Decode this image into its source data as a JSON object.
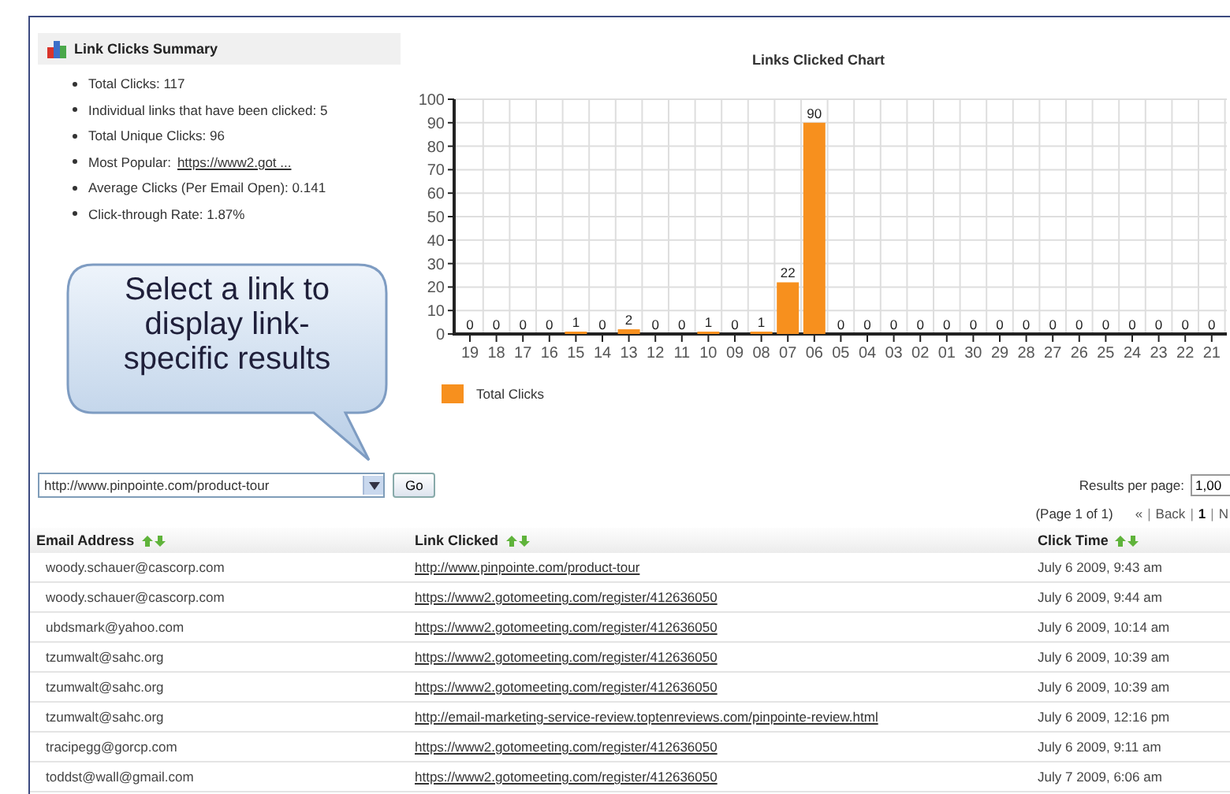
{
  "summary": {
    "title": "Link Clicks Summary",
    "items": [
      {
        "kind": "text",
        "label": "Total Clicks: 117"
      },
      {
        "kind": "text",
        "label": "Individual links that have been clicked: 5"
      },
      {
        "kind": "text",
        "label": "Total Unique Clicks: 96"
      },
      {
        "kind": "link",
        "label": "Most Popular:",
        "link": "https://www2.got ..."
      },
      {
        "kind": "text",
        "label": "Average Clicks (Per Email Open): 0.141"
      },
      {
        "kind": "text",
        "label": "Click-through Rate: 1.87%"
      }
    ]
  },
  "chart_data": {
    "type": "bar",
    "title": "Links Clicked Chart",
    "categories": [
      "19",
      "18",
      "17",
      "16",
      "15",
      "14",
      "13",
      "12",
      "11",
      "10",
      "09",
      "08",
      "07",
      "06",
      "05",
      "04",
      "03",
      "02",
      "01",
      "30",
      "29",
      "28",
      "27",
      "26",
      "25",
      "24",
      "23",
      "22",
      "21"
    ],
    "series": [
      {
        "name": "Total Clicks",
        "color": "#f7901e",
        "values": [
          0,
          0,
          0,
          0,
          1,
          0,
          2,
          0,
          0,
          1,
          0,
          1,
          22,
          90,
          0,
          0,
          0,
          0,
          0,
          0,
          0,
          0,
          0,
          0,
          0,
          0,
          0,
          0,
          0
        ]
      }
    ],
    "ylim": [
      0,
      100
    ],
    "yticks": [
      0,
      10,
      20,
      30,
      40,
      50,
      60,
      70,
      80,
      90,
      100
    ],
    "data_labels": true,
    "grid": true
  },
  "callout": "Select a link to display link-specific results",
  "link_selector": {
    "value": "http://www.pinpointe.com/product-tour"
  },
  "go_button": "Go",
  "results_per_page": {
    "label": "Results per page:",
    "value": "1,00"
  },
  "pagination": {
    "page_info": "(Page 1 of 1)",
    "separator": "|",
    "links": [
      {
        "label": "«",
        "selected": false
      },
      {
        "label": "Back",
        "selected": false
      },
      {
        "label": "1",
        "selected": true
      },
      {
        "label": "N",
        "selected": false
      }
    ]
  },
  "table": {
    "columns": [
      "Email Address",
      "Link Clicked",
      "Click Time"
    ],
    "rows": [
      {
        "email": "woody.schauer@cascorp.com",
        "link": "http://www.pinpointe.com/product-tour",
        "time": "July 6 2009, 9:43 am"
      },
      {
        "email": "woody.schauer@cascorp.com",
        "link": "https://www2.gotomeeting.com/register/412636050",
        "time": "July 6 2009, 9:44 am"
      },
      {
        "email": "ubdsmark@yahoo.com",
        "link": "https://www2.gotomeeting.com/register/412636050",
        "time": "July 6 2009, 10:14 am"
      },
      {
        "email": "tzumwalt@sahc.org",
        "link": "https://www2.gotomeeting.com/register/412636050",
        "time": "July 6 2009, 10:39 am"
      },
      {
        "email": "tzumwalt@sahc.org",
        "link": "https://www2.gotomeeting.com/register/412636050",
        "time": "July 6 2009, 10:39 am"
      },
      {
        "email": "tzumwalt@sahc.org",
        "link": "http://email-marketing-service-review.toptenreviews.com/pinpointe-review.html",
        "time": "July 6 2009, 12:16 pm"
      },
      {
        "email": "tracipegg@gorcp.com",
        "link": "https://www2.gotomeeting.com/register/412636050",
        "time": "July 6 2009, 9:11 am"
      },
      {
        "email": "toddst@wall@gmail.com",
        "link": "https://www2.gotomeeting.com/register/412636050",
        "time": "July 7 2009, 6:06 am"
      }
    ]
  }
}
